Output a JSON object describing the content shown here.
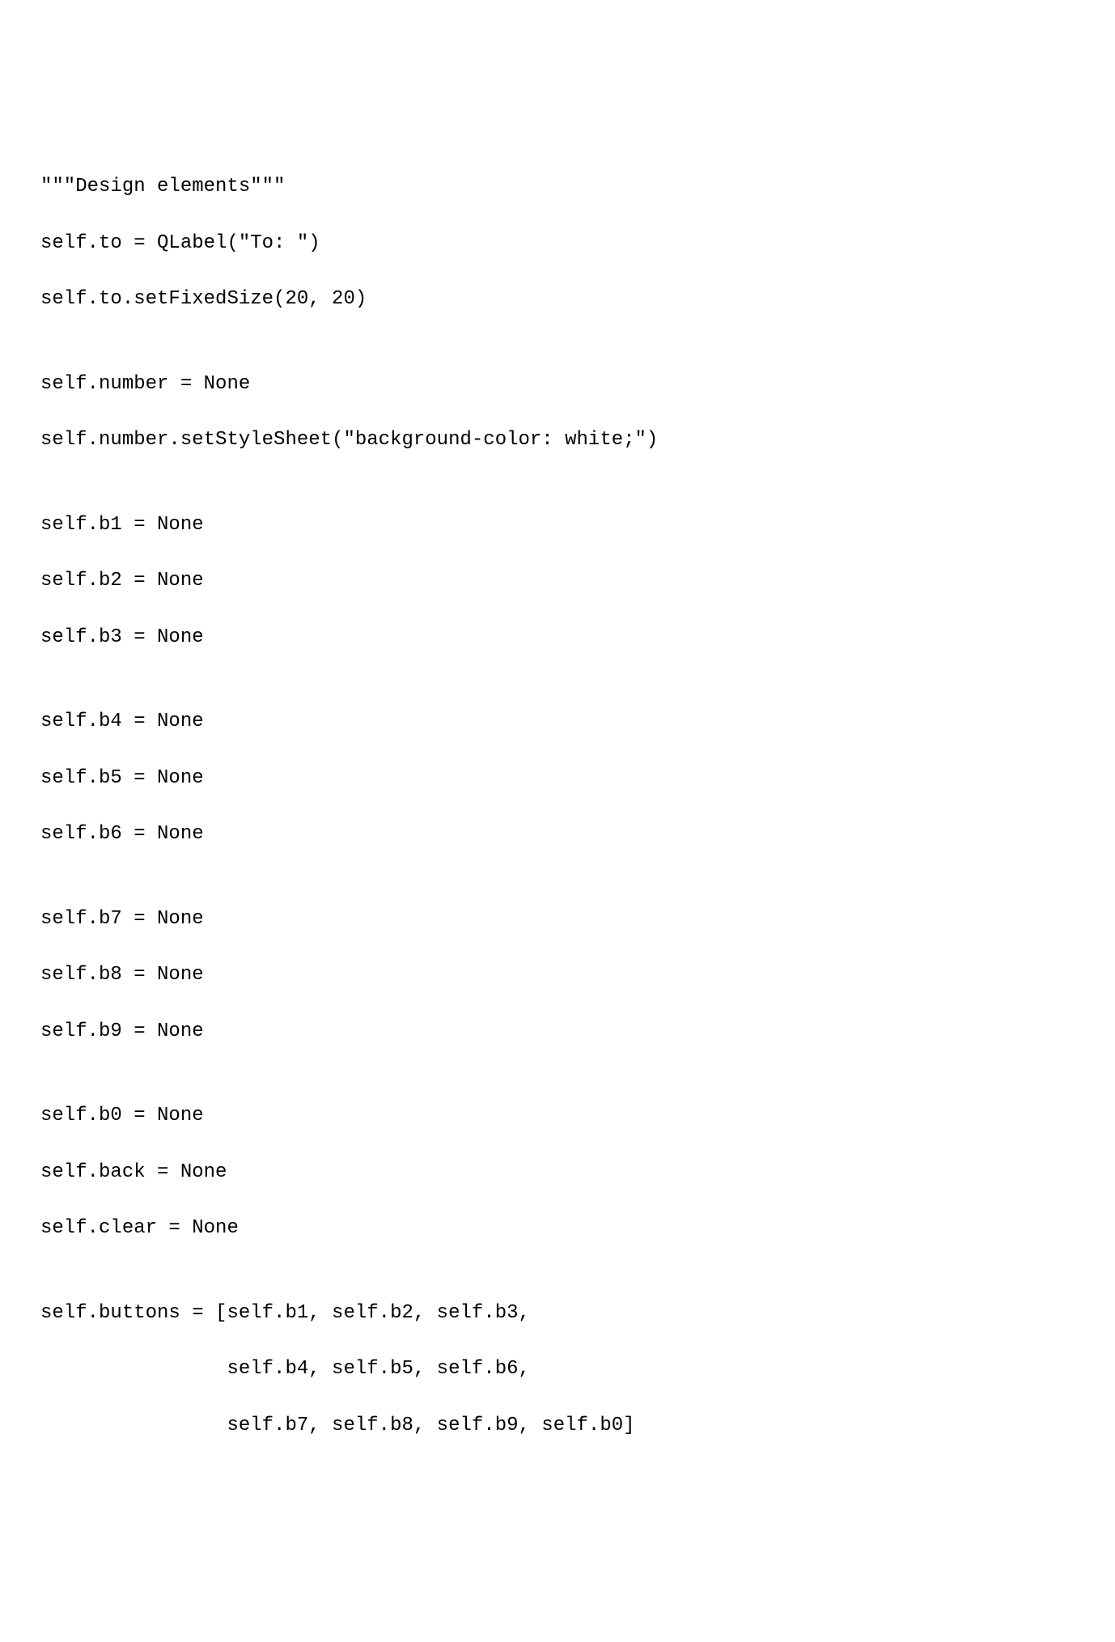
{
  "code": {
    "lines": [
      "\"\"\"Design elements\"\"\"",
      "self.to = QLabel(\"To: \")",
      "self.to.setFixedSize(20, 20)",
      "",
      "self.number = None",
      "self.number.setStyleSheet(\"background-color: white;\")",
      "",
      "self.b1 = None",
      "self.b2 = None",
      "self.b3 = None",
      "",
      "self.b4 = None",
      "self.b5 = None",
      "self.b6 = None",
      "",
      "self.b7 = None",
      "self.b8 = None",
      "self.b9 = None",
      "",
      "self.b0 = None",
      "self.back = None",
      "self.clear = None",
      "",
      "self.buttons = [self.b1, self.b2, self.b3,",
      "                self.b4, self.b5, self.b6,",
      "                self.b7, self.b8, self.b9, self.b0]"
    ]
  }
}
